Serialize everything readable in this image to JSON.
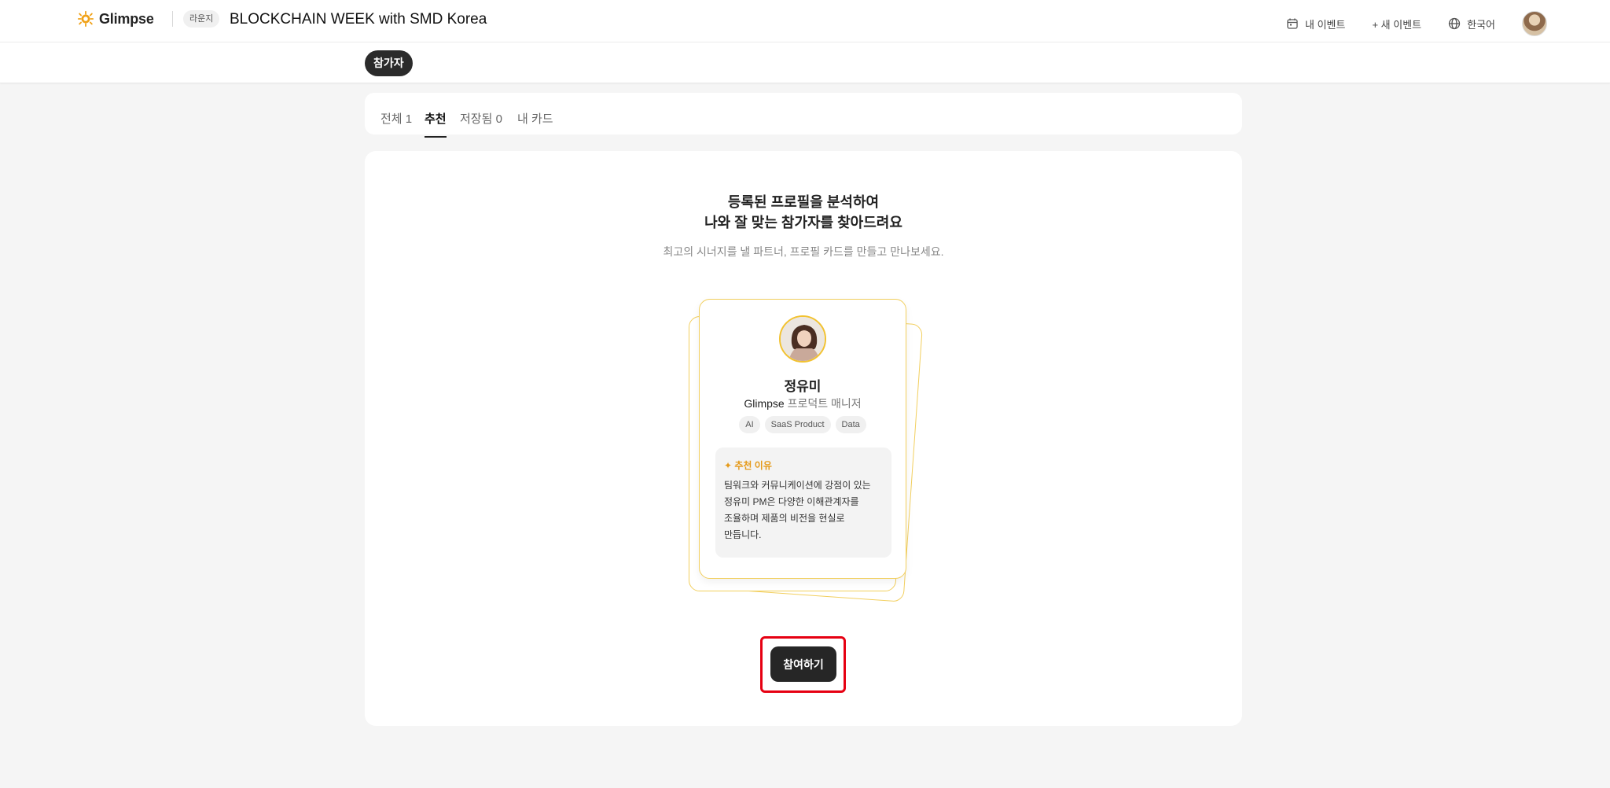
{
  "header": {
    "logo_text": "Glimpse",
    "lounge_label": "라운지",
    "event_title": "BLOCKCHAIN WEEK with SMD Korea",
    "nav": [
      {
        "label": "내 이벤트",
        "icon": "calendar-icon"
      },
      {
        "label": "+ 새 이벤트",
        "icon": ""
      },
      {
        "label": "한국어",
        "icon": "globe-icon"
      }
    ]
  },
  "subnav": {
    "active_chip": "참가자"
  },
  "tabs": [
    {
      "label": "전체 1",
      "active": false
    },
    {
      "label": "추천",
      "active": true
    },
    {
      "label": "저장됨 0",
      "active": false
    },
    {
      "label": "내 카드",
      "active": false
    }
  ],
  "recommend": {
    "headline_line1": "등록된 프로필을 분석하여",
    "headline_line2": "나와 잘 맞는 참가자를 찾아드려요",
    "subline": "최고의 시너지를 낼 파트너, 프로필 카드를 만들고 만나보세요.",
    "profile": {
      "name": "정유미",
      "company": "Glimpse",
      "title": "프로덕트 매니저",
      "tags": [
        "AI",
        "SaaS Product",
        "Data"
      ],
      "reason_title": "✦ 추천 이유",
      "reason_lines": [
        "팀워크와 커뮤니케이션에 강점이 있는",
        "정유미 PM은 다양한 이해관계자를",
        "조율하며 제품의 비전을 현실로",
        "만듭니다."
      ]
    },
    "cta_label": "참여하기"
  },
  "colors": {
    "accent_yellow": "#f2cf5e",
    "reason_orange": "#e59a1a",
    "cta_dark": "#262626",
    "highlight_red": "#e60012"
  }
}
